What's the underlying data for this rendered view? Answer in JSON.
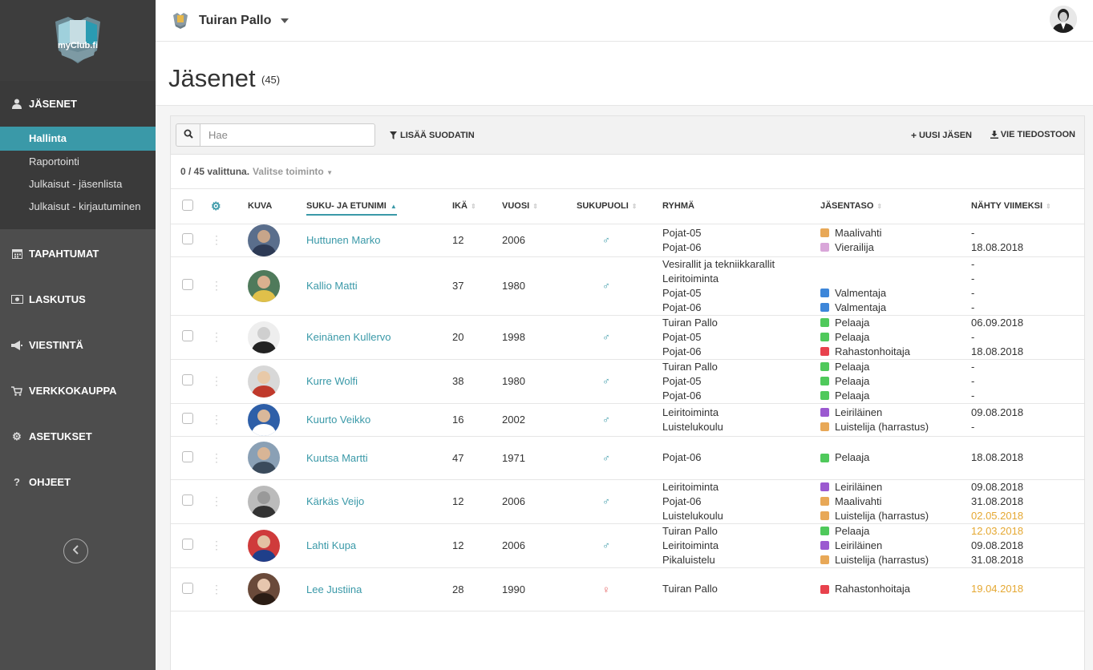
{
  "brand": {
    "logo_text": "myClub.fi"
  },
  "sidebar": {
    "sections": [
      {
        "id": "jasenet",
        "label": "JÄSENET",
        "icon": "user-icon"
      },
      {
        "id": "tapahtumat",
        "label": "TAPAHTUMAT",
        "icon": "calendar-icon"
      },
      {
        "id": "laskutus",
        "label": "LASKUTUS",
        "icon": "money-icon"
      },
      {
        "id": "viestinta",
        "label": "VIESTINTÄ",
        "icon": "megaphone-icon"
      },
      {
        "id": "verkkokauppa",
        "label": "VERKKOKAUPPA",
        "icon": "cart-icon"
      },
      {
        "id": "asetukset",
        "label": "ASETUKSET",
        "icon": "gear-icon"
      },
      {
        "id": "ohjeet",
        "label": "OHJEET",
        "icon": "question-icon"
      }
    ],
    "subitems": [
      "Hallinta",
      "Raportointi",
      "Julkaisut - jäsenlista",
      "Julkaisut - kirjautuminen"
    ]
  },
  "topbar": {
    "club_name": "Tuiran Pallo"
  },
  "page": {
    "title": "Jäsenet",
    "count": "(45)"
  },
  "toolbar": {
    "search_placeholder": "Hae",
    "add_filter": "LISÄÄ SUODATIN",
    "new_member": "UUSI JÄSEN",
    "export": "VIE TIEDOSTOON"
  },
  "selection": {
    "text": "0 / 45 valittuna.",
    "action": "Valitse toiminto"
  },
  "table": {
    "headers": {
      "photo": "KUVA",
      "name": "SUKU- JA ETUNIMI",
      "age": "IKÄ",
      "year": "VUOSI",
      "gender": "SUKUPUOLI",
      "group": "RYHMÄ",
      "level": "JÄSENTASO",
      "seen": "NÄHTY VIIMEKSI"
    },
    "rows": [
      {
        "name": "Huttunen Marko",
        "age": "12",
        "year": "2006",
        "gender": "♂",
        "groups": [
          "Pojat-05",
          "Pojat-06"
        ],
        "levels": [
          {
            "label": "Maalivahti",
            "color": "#e8a857"
          },
          {
            "label": "Vierailija",
            "color": "#d9a6d9"
          }
        ],
        "seen": [
          {
            "v": "-"
          },
          {
            "v": "18.08.2018"
          }
        ]
      },
      {
        "name": "Kallio Matti",
        "age": "37",
        "year": "1980",
        "gender": "♂",
        "groups": [
          "Vesirallit ja tekniikkarallit",
          "Leiritoiminta",
          "Pojat-05",
          "Pojat-06"
        ],
        "levels": [
          {
            "label": "",
            "color": ""
          },
          {
            "label": "",
            "color": ""
          },
          {
            "label": "Valmentaja",
            "color": "#3d86d9"
          },
          {
            "label": "Valmentaja",
            "color": "#3d86d9"
          }
        ],
        "seen": [
          {
            "v": "-"
          },
          {
            "v": "-"
          },
          {
            "v": "-"
          },
          {
            "v": "-"
          }
        ]
      },
      {
        "name": "Keinänen Kullervo",
        "age": "20",
        "year": "1998",
        "gender": "♂",
        "groups": [
          "Tuiran Pallo",
          "Pojat-05",
          "Pojat-06"
        ],
        "levels": [
          {
            "label": "Pelaaja",
            "color": "#4fc95b"
          },
          {
            "label": "Pelaaja",
            "color": "#4fc95b"
          },
          {
            "label": "Rahastonhoitaja",
            "color": "#e8424d"
          }
        ],
        "seen": [
          {
            "v": "06.09.2018"
          },
          {
            "v": "-"
          },
          {
            "v": "18.08.2018"
          }
        ]
      },
      {
        "name": "Kurre Wolfi",
        "age": "38",
        "year": "1980",
        "gender": "♂",
        "groups": [
          "Tuiran Pallo",
          "Pojat-05",
          "Pojat-06"
        ],
        "levels": [
          {
            "label": "Pelaaja",
            "color": "#4fc95b"
          },
          {
            "label": "Pelaaja",
            "color": "#4fc95b"
          },
          {
            "label": "Pelaaja",
            "color": "#4fc95b"
          }
        ],
        "seen": [
          {
            "v": "-"
          },
          {
            "v": "-"
          },
          {
            "v": "-"
          }
        ]
      },
      {
        "name": "Kuurto Veikko",
        "age": "16",
        "year": "2002",
        "gender": "♂",
        "groups": [
          "Leiritoiminta",
          "Luistelukoulu"
        ],
        "levels": [
          {
            "label": "Leiriläinen",
            "color": "#9b59d0"
          },
          {
            "label": "Luistelija (harrastus)",
            "color": "#e8a857"
          }
        ],
        "seen": [
          {
            "v": "09.08.2018"
          },
          {
            "v": "-"
          }
        ]
      },
      {
        "name": "Kuutsa Martti",
        "age": "47",
        "year": "1971",
        "gender": "♂",
        "groups": [
          "Pojat-06"
        ],
        "levels": [
          {
            "label": "Pelaaja",
            "color": "#4fc95b"
          }
        ],
        "seen": [
          {
            "v": "18.08.2018"
          }
        ]
      },
      {
        "name": "Kärkäs Veijo",
        "age": "12",
        "year": "2006",
        "gender": "♂",
        "groups": [
          "Leiritoiminta",
          "Pojat-06",
          "Luistelukoulu"
        ],
        "levels": [
          {
            "label": "Leiriläinen",
            "color": "#9b59d0"
          },
          {
            "label": "Maalivahti",
            "color": "#e8a857"
          },
          {
            "label": "Luistelija (harrastus)",
            "color": "#e8a857"
          }
        ],
        "seen": [
          {
            "v": "09.08.2018"
          },
          {
            "v": "31.08.2018"
          },
          {
            "v": "02.05.2018",
            "old": true
          }
        ]
      },
      {
        "name": "Lahti Kupa",
        "age": "12",
        "year": "2006",
        "gender": "♂",
        "groups": [
          "Tuiran Pallo",
          "Leiritoiminta",
          "Pikaluistelu"
        ],
        "levels": [
          {
            "label": "Pelaaja",
            "color": "#4fc95b"
          },
          {
            "label": "Leiriläinen",
            "color": "#9b59d0"
          },
          {
            "label": "Luistelija (harrastus)",
            "color": "#e8a857"
          }
        ],
        "seen": [
          {
            "v": "12.03.2018",
            "old": true
          },
          {
            "v": "09.08.2018"
          },
          {
            "v": "31.08.2018"
          }
        ]
      },
      {
        "name": "Lee Justiina",
        "age": "28",
        "year": "1990",
        "gender": "♀",
        "groups": [
          "Tuiran Pallo"
        ],
        "levels": [
          {
            "label": "Rahastonhoitaja",
            "color": "#e8424d"
          }
        ],
        "seen": [
          {
            "v": "19.04.2018",
            "old": true
          }
        ]
      }
    ]
  },
  "colors": {
    "accent": "#3a99a8",
    "sidebar": "#4d4d4d",
    "stale_date": "#e5a832"
  }
}
